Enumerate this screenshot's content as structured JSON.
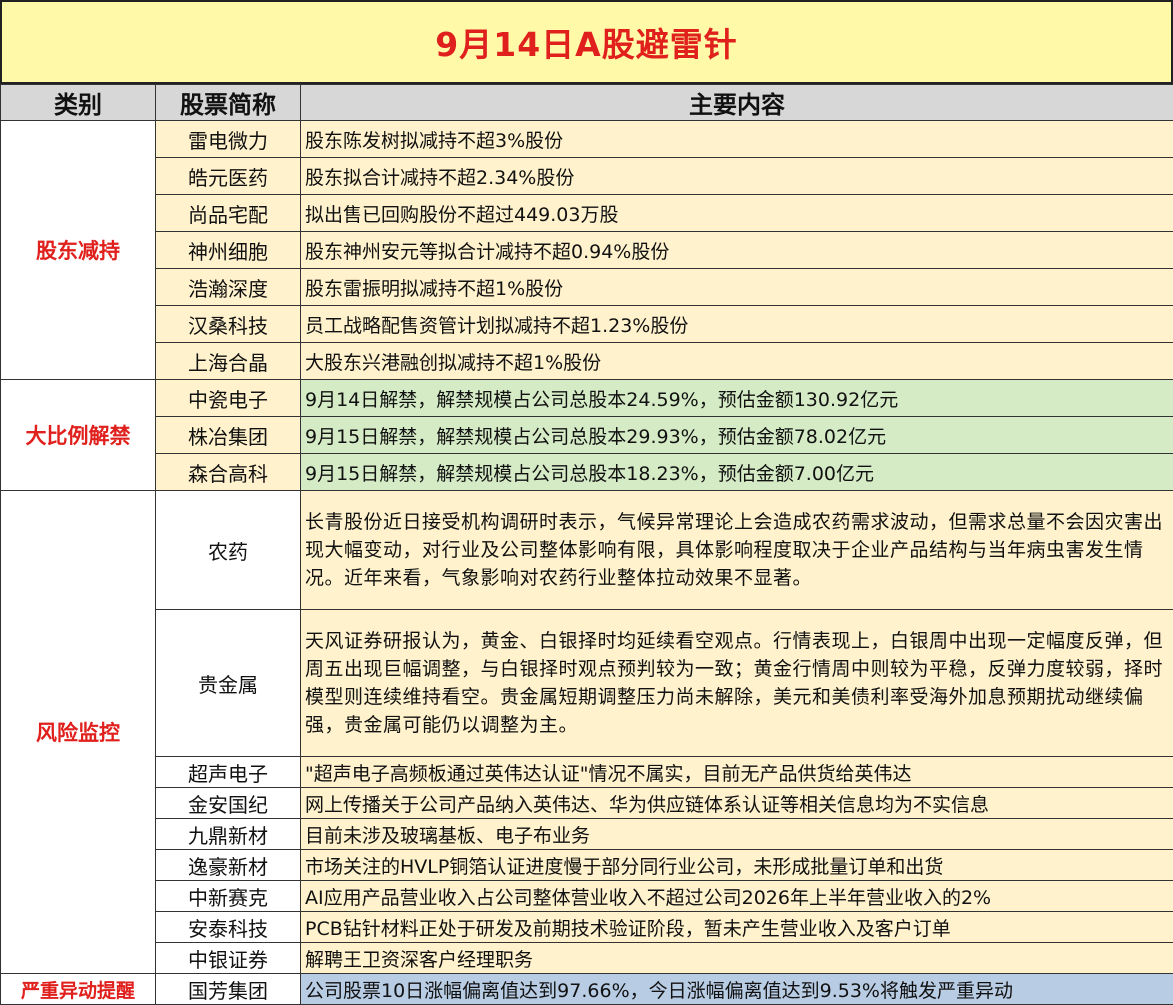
{
  "title": "9月14日A股避雷针",
  "headers": {
    "category": "类别",
    "stock": "股票简称",
    "content": "主要内容"
  },
  "sections": {
    "reduction": {
      "category": "股东减持",
      "rows": [
        {
          "name": "雷电微力",
          "content": "股东陈发树拟减持不超3%股份"
        },
        {
          "name": "皓元医药",
          "content": "股东拟合计减持不超2.34%股份"
        },
        {
          "name": "尚品宅配",
          "content": "拟出售已回购股份不超过449.03万股"
        },
        {
          "name": "神州细胞",
          "content": "股东神州安元等拟合计减持不超0.94%股份"
        },
        {
          "name": "浩瀚深度",
          "content": "股东雷振明拟减持不超1%股份"
        },
        {
          "name": "汉桑科技",
          "content": "员工战略配售资管计划拟减持不超1.23%股份"
        },
        {
          "name": "上海合晶",
          "content": "大股东兴港融创拟减持不超1%股份"
        }
      ]
    },
    "unlock": {
      "category": "大比例解禁",
      "rows": [
        {
          "name": "中瓷电子",
          "content": "9月14日解禁，解禁规模占公司总股本24.59%，预估金额130.92亿元"
        },
        {
          "name": "株冶集团",
          "content": "9月15日解禁，解禁规模占公司总股本29.93%，预估金额78.02亿元"
        },
        {
          "name": "森合高科",
          "content": "9月15日解禁，解禁规模占公司总股本18.23%，预估金额7.00亿元"
        }
      ]
    },
    "risk": {
      "category": "风险监控",
      "rows": [
        {
          "name": "农药",
          "content": "长青股份近日接受机构调研时表示，气候异常理论上会造成农药需求波动，但需求总量不会因灾害出现大幅变动，对行业及公司整体影响有限，具体影响程度取决于企业产品结构与当年病虫害发生情况。近年来看，气象影响对农药行业整体拉动效果不显著。"
        },
        {
          "name": "贵金属",
          "content": "天风证券研报认为，黄金、白银择时均延续看空观点。行情表现上，白银周中出现一定幅度反弹，但周五出现巨幅调整，与白银择时观点预判较为一致；黄金行情周中则较为平稳，反弹力度较弱，择时模型则连续维持看空。贵金属短期调整压力尚未解除，美元和美债利率受海外加息预期扰动继续偏强，贵金属可能仍以调整为主。"
        },
        {
          "name": "超声电子",
          "content": "\"超声电子高频板通过英伟达认证\"情况不属实，目前无产品供货给英伟达"
        },
        {
          "name": "金安国纪",
          "content": "网上传播关于公司产品纳入英伟达、华为供应链体系认证等相关信息均为不实信息"
        },
        {
          "name": "九鼎新材",
          "content": "目前未涉及玻璃基板、电子布业务"
        },
        {
          "name": "逸豪新材",
          "content": "市场关注的HVLP铜箔认证进度慢于部分同行业公司，未形成批量订单和出货"
        },
        {
          "name": "中新赛克",
          "content": "AI应用产品营业收入占公司整体营业收入不超过公司2026年上半年营业收入的2%"
        },
        {
          "name": "安泰科技",
          "content": "PCB钻针材料正处于研发及前期技术验证阶段，暂未产生营业收入及客户订单"
        },
        {
          "name": "中银证券",
          "content": "解聘王卫资深客户经理职务"
        }
      ]
    },
    "alert": {
      "category": "严重异动提醒",
      "rows": [
        {
          "name": "国芳集团",
          "content": "公司股票10日涨幅偏离值达到97.66%，今日涨幅偏离值达到9.53%将触发严重异动"
        }
      ]
    }
  },
  "colors": {
    "title_bg": "#fff9a8",
    "title_text": "#e0201c",
    "header_bg": "#d7d7d7",
    "yellow": "#fff2cc",
    "green": "#d5ebc6",
    "blue": "#b8cce4",
    "category_text": "#e0201c"
  }
}
